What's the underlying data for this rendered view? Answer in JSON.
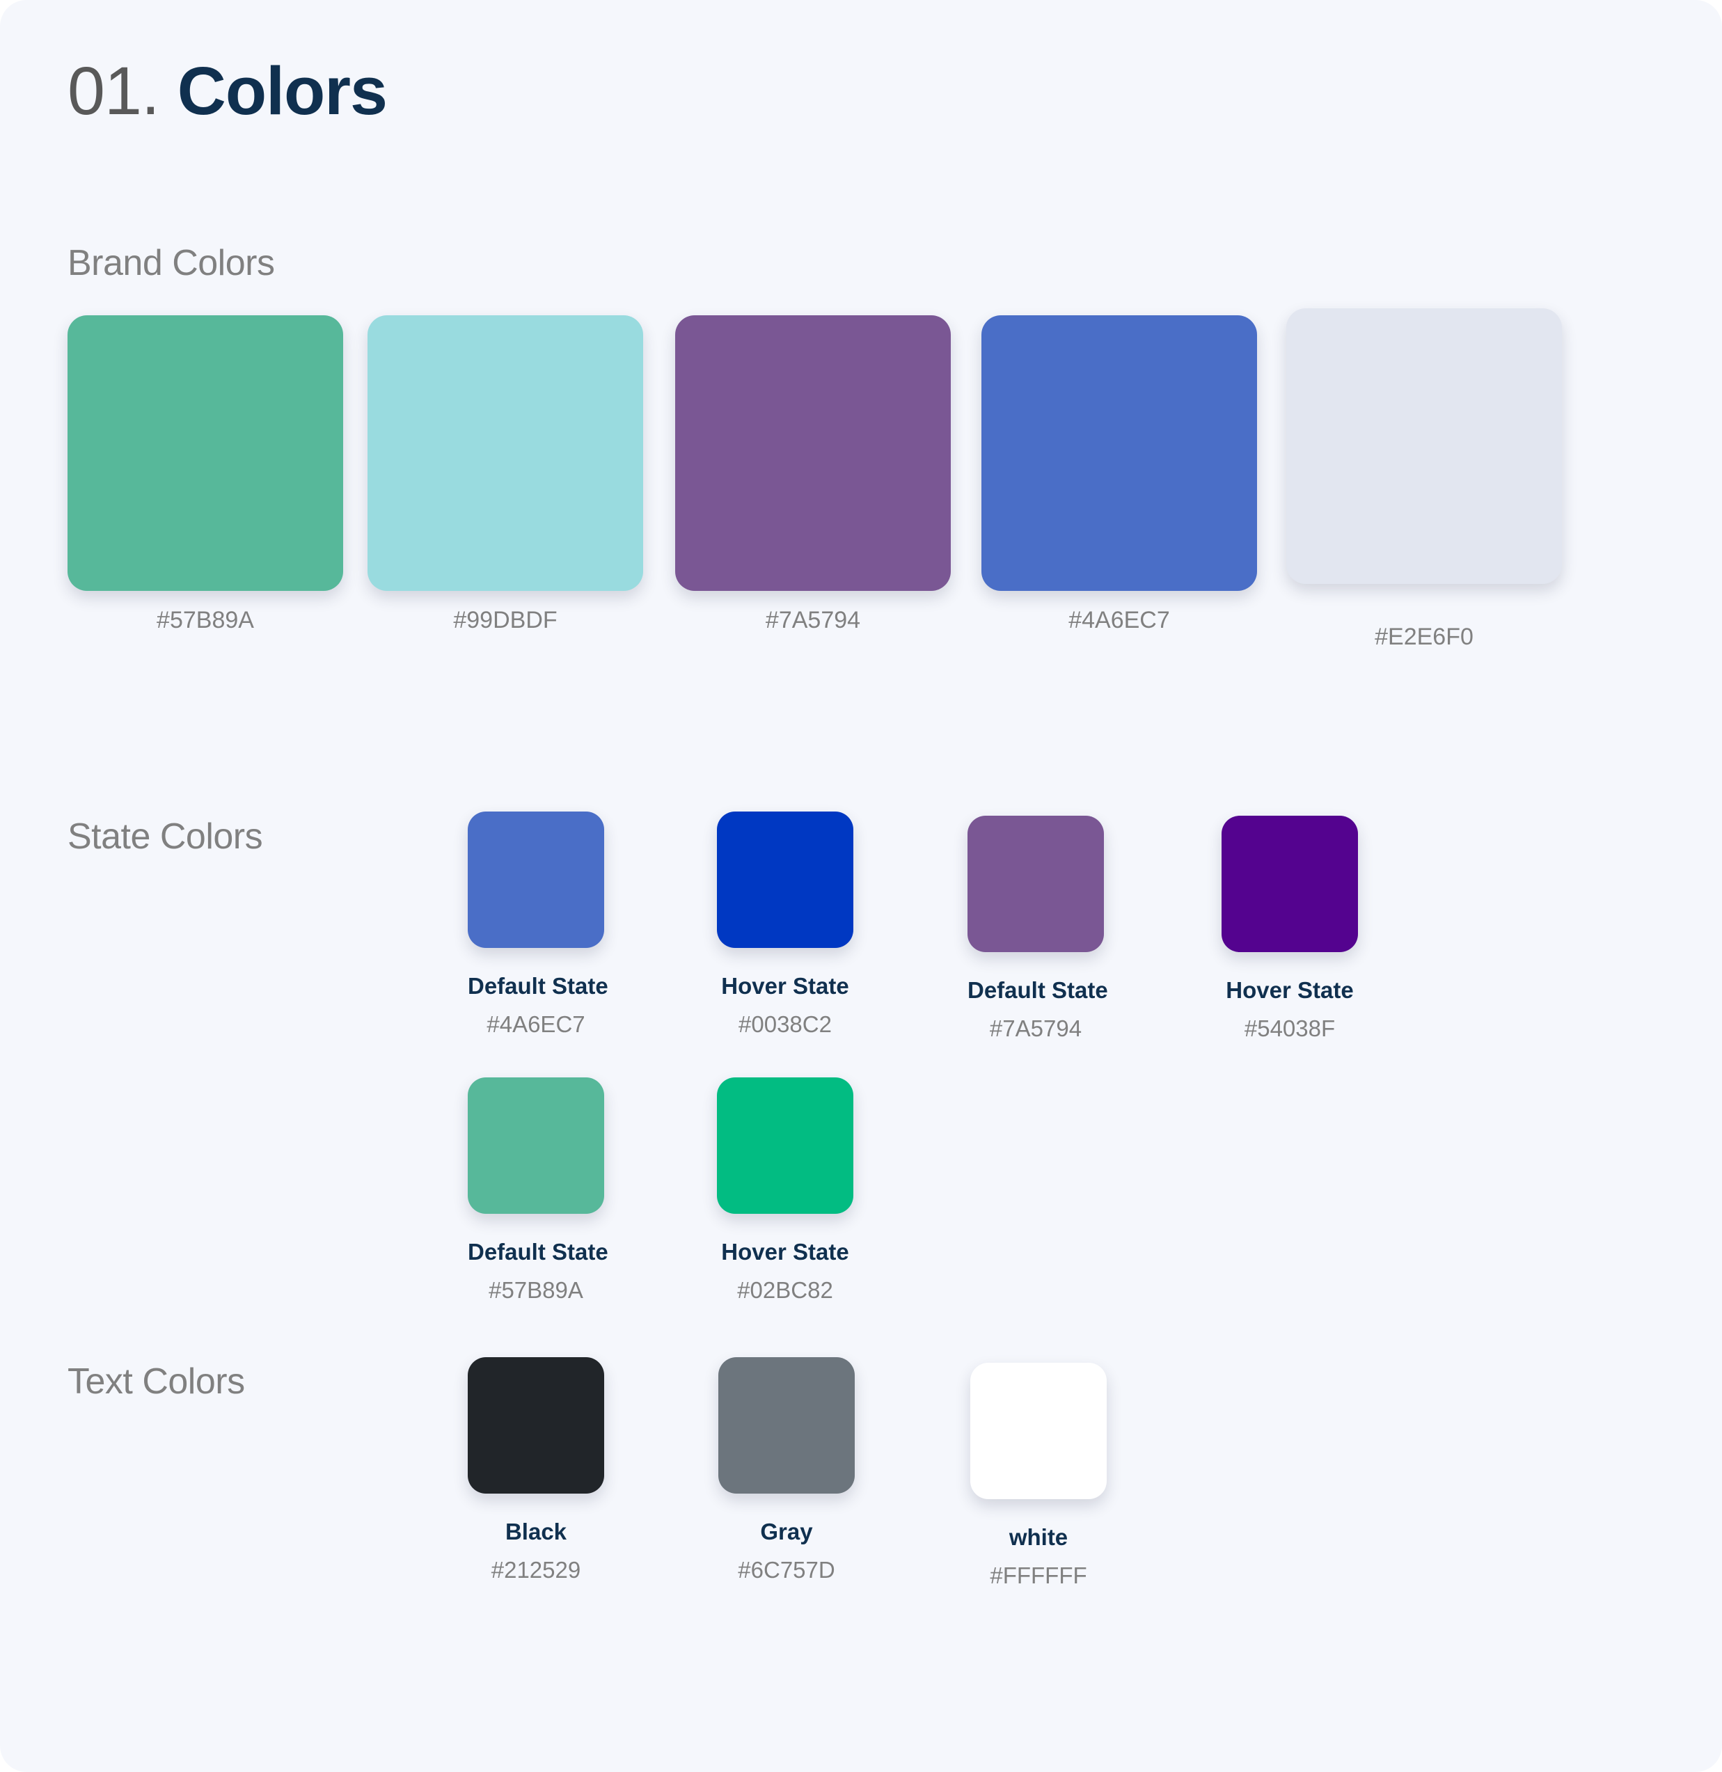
{
  "title": {
    "number": "01.",
    "word": "Colors"
  },
  "sections": {
    "brand": {
      "heading": "Brand Colors",
      "swatches": [
        {
          "hex": "#57B89A"
        },
        {
          "hex": "#99DBDF"
        },
        {
          "hex": "#7A5794"
        },
        {
          "hex": "#4A6EC7"
        },
        {
          "hex": "#E2E6F0"
        }
      ]
    },
    "state": {
      "heading": "State Colors",
      "swatches": [
        {
          "name": "Default State",
          "hex": "#4A6EC7"
        },
        {
          "name": "Hover State",
          "hex": "#0038C2"
        },
        {
          "name": "Default State",
          "hex": "#7A5794"
        },
        {
          "name": "Hover State",
          "hex": "#54038F"
        },
        {
          "name": "Default State",
          "hex": "#57B89A"
        },
        {
          "name": "Hover State",
          "hex": "#02BC82"
        }
      ]
    },
    "text": {
      "heading": "Text Colors",
      "swatches": [
        {
          "name": "Black",
          "hex": "#212529"
        },
        {
          "name": "Gray",
          "hex": "#6C757D"
        },
        {
          "name": "white",
          "hex": "#FFFFFF"
        }
      ]
    }
  },
  "theme": {
    "background": "#F5F7FC",
    "title_accent": "#10304F",
    "muted_text": "#808080"
  }
}
